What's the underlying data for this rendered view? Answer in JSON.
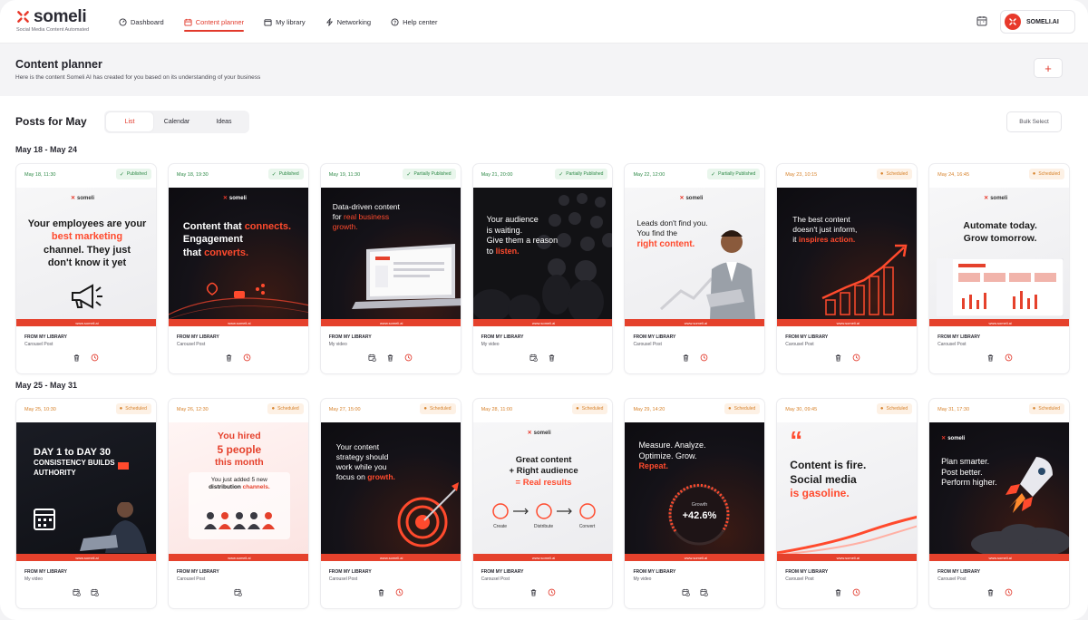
{
  "app": {
    "logo_text": "someli",
    "tagline": "Social Media Content Automated",
    "account_name": "SOMELI.AI"
  },
  "nav": [
    {
      "label": "Dashboard",
      "icon": "dashboard-icon",
      "active": false
    },
    {
      "label": "Content planner",
      "icon": "calendar-icon",
      "active": true
    },
    {
      "label": "My library",
      "icon": "library-icon",
      "active": false
    },
    {
      "label": "Networking",
      "icon": "networking-icon",
      "active": false
    },
    {
      "label": "Help center",
      "icon": "help-icon",
      "active": false
    }
  ],
  "header": {
    "title": "Content planner",
    "subtitle": "Here is the content Someli AI has created for you based on its understanding of your business",
    "add_label": "+"
  },
  "posts": {
    "title": "Posts for May",
    "tabs": [
      "List",
      "Calendar",
      "Ideas"
    ],
    "active_tab": "List",
    "bulk_label": "Bulk Select"
  },
  "colors": {
    "accent": "#e23a2c",
    "published": "#2f8a48",
    "scheduled": "#d7822b"
  },
  "weeks": [
    {
      "label": "May 18 - May 24",
      "cards": [
        {
          "date": "May 18, 11:30",
          "status": "Published",
          "status_type": "published",
          "source": "FROM MY LIBRARY",
          "format": "Carousel Post",
          "actions": [
            "trash-icon",
            "clock-icon"
          ]
        },
        {
          "date": "May 18, 19:30",
          "status": "Published",
          "status_type": "published",
          "source": "FROM MY LIBRARY",
          "format": "Carousel Post",
          "actions": [
            "trash-icon",
            "clock-icon"
          ]
        },
        {
          "date": "May 19, 11:30",
          "status": "Partially Published",
          "status_type": "partial",
          "source": "FROM MY LIBRARY",
          "format": "My video",
          "actions": [
            "reschedule-icon",
            "trash-icon",
            "clock-icon"
          ]
        },
        {
          "date": "May 21, 20:00",
          "status": "Partially Published",
          "status_type": "partial",
          "source": "FROM MY LIBRARY",
          "format": "My video",
          "actions": [
            "reschedule-icon",
            "trash-icon"
          ]
        },
        {
          "date": "May 22, 12:00",
          "status": "Partially Published",
          "status_type": "partial",
          "source": "FROM MY LIBRARY",
          "format": "Carousel Post",
          "actions": [
            "trash-icon",
            "clock-icon"
          ]
        },
        {
          "date": "May 23, 10:15",
          "status": "Scheduled",
          "status_type": "scheduled",
          "source": "FROM MY LIBRARY",
          "format": "Carousel Post",
          "actions": [
            "trash-icon",
            "clock-icon"
          ]
        },
        {
          "date": "May 24, 16:45",
          "status": "Scheduled",
          "status_type": "scheduled",
          "source": "FROM MY LIBRARY",
          "format": "Carousel Post",
          "actions": [
            "trash-icon",
            "clock-icon"
          ]
        }
      ]
    },
    {
      "label": "May 25 - May 31",
      "cards": [
        {
          "date": "May 25, 10:30",
          "status": "Scheduled",
          "status_type": "scheduled",
          "source": "FROM MY LIBRARY",
          "format": "My video",
          "actions": [
            "reschedule-icon",
            "reschedule-icon"
          ]
        },
        {
          "date": "May 26, 12:30",
          "status": "Scheduled",
          "status_type": "scheduled",
          "source": "FROM MY LIBRARY",
          "format": "Carousel Post",
          "actions": [
            "reschedule-icon"
          ]
        },
        {
          "date": "May 27, 15:00",
          "status": "Scheduled",
          "status_type": "scheduled",
          "source": "FROM MY LIBRARY",
          "format": "Carousel Post",
          "actions": [
            "trash-icon",
            "clock-icon"
          ]
        },
        {
          "date": "May 28, 11:00",
          "status": "Scheduled",
          "status_type": "scheduled",
          "source": "FROM MY LIBRARY",
          "format": "Carousel Post",
          "actions": [
            "trash-icon",
            "clock-icon"
          ]
        },
        {
          "date": "May 29, 14:20",
          "status": "Scheduled",
          "status_type": "scheduled",
          "source": "FROM MY LIBRARY",
          "format": "My video",
          "actions": [
            "reschedule-icon",
            "reschedule-icon"
          ]
        },
        {
          "date": "May 30, 09:45",
          "status": "Scheduled",
          "status_type": "scheduled",
          "source": "FROM MY LIBRARY",
          "format": "Carousel Post",
          "actions": [
            "trash-icon",
            "clock-icon"
          ]
        },
        {
          "date": "May 31, 17:30",
          "status": "Scheduled",
          "status_type": "scheduled",
          "source": "FROM MY LIBRARY",
          "format": "Carousel Post",
          "actions": [
            "trash-icon",
            "clock-icon"
          ]
        }
      ]
    }
  ],
  "thumbs": {
    "footer": "www.someli.ai",
    "logo": "someli",
    "w1c1": {
      "l1": "Your employees are your",
      "l2": "best marketing",
      "l3": "channel. They just",
      "l4": "don't know it yet"
    },
    "w1c2": {
      "l1a": "Content that ",
      "l1b": "connects.",
      "l2": "Engagement",
      "l3a": "that ",
      "l3b": "converts."
    },
    "w1c3": {
      "l1": "Data-driven content",
      "l2a": "for ",
      "l2b": "real business",
      "l3": "growth."
    },
    "w1c4": {
      "l1": "Your audience",
      "l2": "is waiting.",
      "l3": "Give them a reason",
      "l4a": "to ",
      "l4b": "listen."
    },
    "w1c5": {
      "l1": "Leads don't find you.",
      "l2": "You find the",
      "l3": "right content."
    },
    "w1c6": {
      "l1": "The best content",
      "l2": "doesn't just inform,",
      "l3a": "it ",
      "l3b": "inspires action."
    },
    "w1c7": {
      "l1": "Automate today.",
      "l2": "Grow tomorrow."
    },
    "w2c1": {
      "l1": "DAY 1 to DAY 30",
      "l2": "CONSISTENCY BUILDS",
      "l3": "AUTHORITY"
    },
    "w2c2": {
      "l1": "You hired",
      "l2": "5 people",
      "l3": "this month",
      "s1": "You just added 5 new",
      "s2a": "distribution ",
      "s2b": "channels."
    },
    "w2c3": {
      "l1": "Your content",
      "l2": "strategy should",
      "l3": "work while you",
      "l4a": "focus on ",
      "l4b": "growth."
    },
    "w2c4": {
      "l1": "Great content",
      "l2": "+ Right audience",
      "l3": "= Real results",
      "f1": "Create",
      "f2": "Distribute",
      "f3": "Convert"
    },
    "w2c5": {
      "l1": "Measure. Analyze.",
      "l2": "Optimize. Grow.",
      "l3": "Repeat.",
      "g1": "Growth",
      "g2": "+42.6%"
    },
    "w2c6": {
      "q": "“",
      "l1": "Content is fire.",
      "l2": "Social media",
      "l3": "is gasoline."
    },
    "w2c7": {
      "l1": "Plan smarter.",
      "l2": "Post better.",
      "l3": "Perform higher."
    }
  }
}
